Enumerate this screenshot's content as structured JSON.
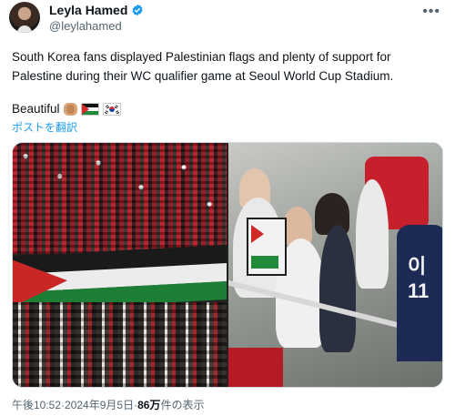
{
  "author": {
    "name": "Leyla Hamed",
    "handle": "@leylahamed",
    "verified_color": "#1d9bf0"
  },
  "tweet": {
    "text_line1": "South Korea fans displayed Palestinian flags and plenty of support for",
    "text_line2": "Palestine during their WC qualifier game at Seoul World Cup Stadium.",
    "beautiful": "Beautiful",
    "emojis": [
      "clapping-hands-icon",
      "palestine-flag-icon",
      "south-korea-flag-icon"
    ],
    "translate_label": "ポストを翻訳"
  },
  "media": {
    "left_photo": "stadium-crowd-with-palestinian-flag",
    "right_photo": "fans-holding-palestinian-flag-sign",
    "jersey_text": "이 11"
  },
  "meta": {
    "time": "午後10:52",
    "separator1": " · ",
    "date": "2024年9月5日",
    "separator2": " · ",
    "views_count": "86万",
    "views_label": " 件の表示"
  },
  "colors": {
    "accent": "#1d9bf0",
    "text": "#0f1419",
    "muted": "#536471",
    "palestine_black": "#111111",
    "palestine_white": "#f5f5f5",
    "palestine_green": "#1f8a3a",
    "palestine_red": "#cf2a2a"
  }
}
